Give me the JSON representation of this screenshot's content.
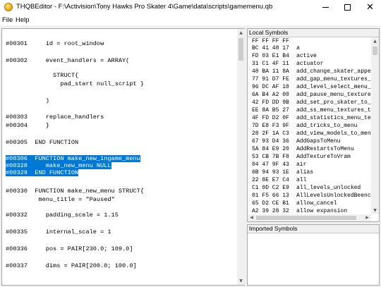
{
  "window": {
    "title": "THQBEditor - F:\\Activision\\Tony Hawks Pro Skater 4\\Game\\data\\scripts\\gamemenu.qb",
    "icon": "app-icon",
    "minimize_icon": "minimize-icon",
    "maximize_icon": "maximize-icon",
    "close_glyph": "✕"
  },
  "menu": {
    "file": "File",
    "help": "Help"
  },
  "editor": {
    "selection_color": "#0078d7",
    "lines": [
      {
        "text": "#00301     id = root_window",
        "selected": false
      },
      {
        "text": "#00302     event_handlers = ARRAY(",
        "selected": false
      },
      {
        "text": "             STRUCT{",
        "selected": false
      },
      {
        "text": "               pad_start null_script }",
        "selected": false
      },
      {
        "text": "           )",
        "selected": false
      },
      {
        "text": "#00303     replace_handlers",
        "selected": false
      },
      {
        "text": "#00304     }",
        "selected": false
      },
      {
        "text": "#00305  END FUNCTION",
        "selected": false
      },
      {
        "text": "#00306  FUNCTION make_new_ingame_menu",
        "selected": true
      },
      {
        "text": "#00328     make_new_menu NULL",
        "selected": true
      },
      {
        "text": "#00329  END FUNCTION",
        "selected": true
      },
      {
        "text": "#00330  FUNCTION make_new_menu STRUCT{",
        "selected": false
      },
      {
        "text": "         menu_title = \"Paused\"",
        "selected": false
      },
      {
        "text": "#00332     padding_scale = 1.15",
        "selected": false
      },
      {
        "text": "#00335     internal_scale = 1",
        "selected": false
      },
      {
        "text": "#00336     pos = PAIR[230.0; 109.0]",
        "selected": false
      },
      {
        "text": "#00337     dims = PAIR[200.0; 100.0]",
        "selected": false
      }
    ]
  },
  "local_symbols": {
    "header": "Local Symbols",
    "rows": [
      {
        "hex": "FF FF FF FF",
        "name": ""
      },
      {
        "hex": "BC 41 48 17",
        "name": "a"
      },
      {
        "hex": "FD 03 E1 B4",
        "name": "active"
      },
      {
        "hex": "31 C1 4F 11",
        "name": "actuator"
      },
      {
        "hex": "48 BA 11 8A",
        "name": "add_change_skater_appe"
      },
      {
        "hex": "77 91 D7 FE",
        "name": "add_gap_menu_textures_"
      },
      {
        "hex": "96 DC AF 10",
        "name": "add_level_select_menu_"
      },
      {
        "hex": "6A B4 A2 00",
        "name": "add_pause_menu_texture"
      },
      {
        "hex": "42 FD DD 9B",
        "name": "add_set_pro_skater_to_"
      },
      {
        "hex": "EE 8A B5 27",
        "name": "add_ss_menu_textures_t"
      },
      {
        "hex": "4F FD D2 0F",
        "name": "add_statistics_menu_te"
      },
      {
        "hex": "7D E8 F3 9F",
        "name": "add_tricks_to_menu"
      },
      {
        "hex": "28 2F 1A C3",
        "name": "add_view_models_to_men"
      },
      {
        "hex": "67 93 D4 36",
        "name": "AddGapsToMenu"
      },
      {
        "hex": "5A 84 E9 20",
        "name": "AddRestartsToMenu"
      },
      {
        "hex": "53 CB 7B F8",
        "name": "AddTextureToVram"
      },
      {
        "hex": "04 47 9F 43",
        "name": "air"
      },
      {
        "hex": "6B 94 93 1E",
        "name": "alias"
      },
      {
        "hex": "22 8E E7 C4",
        "name": "all"
      },
      {
        "hex": "C1 0D C2 E9",
        "name": "all_levels_unlocked"
      },
      {
        "hex": "01 F5 66 13",
        "name": "AllLevelsUnlockedBeenc"
      },
      {
        "hex": "65 D2 CE B1",
        "name": "allow_cancel"
      },
      {
        "hex": "A2 39 28 32",
        "name": "allow expansion"
      }
    ]
  },
  "imported_symbols": {
    "header": "Imported Symbols"
  },
  "scrollbars": {
    "up_glyph": "▲",
    "down_glyph": "▼",
    "left_glyph": "◀",
    "right_glyph": "▶"
  }
}
